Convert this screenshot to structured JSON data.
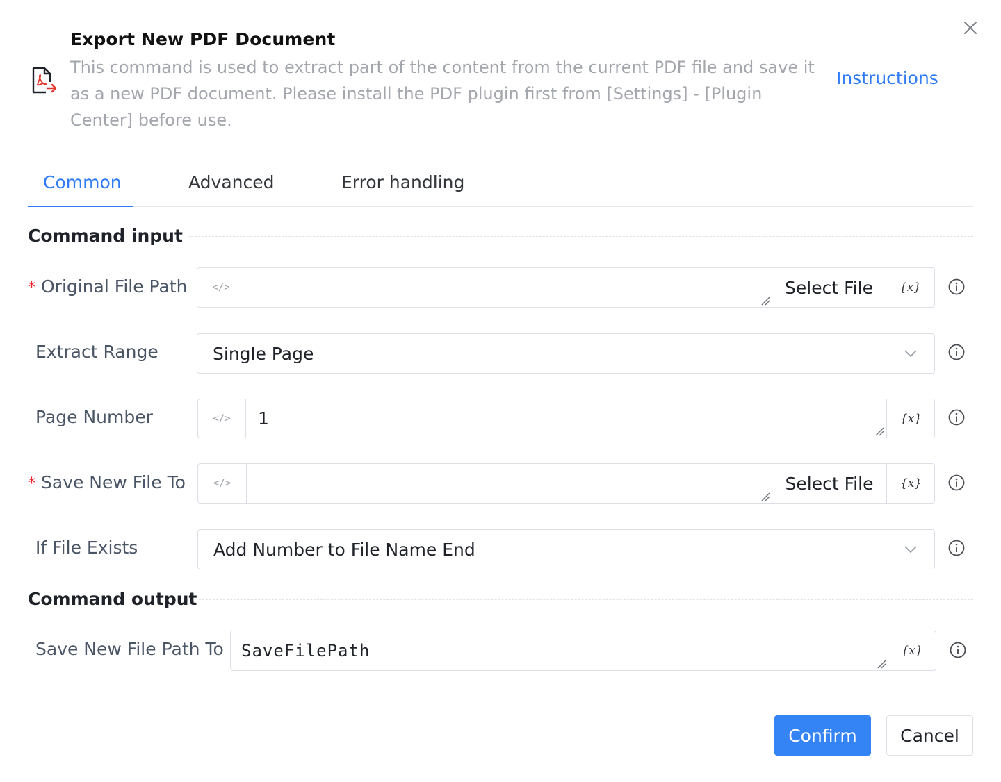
{
  "header": {
    "title": "Export New PDF Document",
    "description": "This command is used to extract part of the content from the current PDF file and save it as a new PDF document. Please install the PDF plugin first from [Settings] - [Plugin Center] before use.",
    "instructions_link": "Instructions",
    "icon": "pdf-export-icon"
  },
  "tabs": [
    {
      "label": "Common",
      "active": true
    },
    {
      "label": "Advanced",
      "active": false
    },
    {
      "label": "Error handling",
      "active": false
    }
  ],
  "sections": {
    "input_title": "Command input",
    "output_title": "Command output"
  },
  "fields": {
    "original_file_path": {
      "label": "Original File Path",
      "required_mark": "*",
      "value": "",
      "button": "Select File"
    },
    "extract_range": {
      "label": "Extract Range",
      "value": "Single Page"
    },
    "page_number": {
      "label": "Page Number",
      "value": "1"
    },
    "save_new_file_to": {
      "label": "Save New File To",
      "required_mark": "*",
      "value": "",
      "button": "Select File"
    },
    "if_file_exists": {
      "label": "If File Exists",
      "value": "Add Number to File Name End"
    },
    "save_new_file_path_to": {
      "label": "Save New File Path To",
      "value": "SaveFilePath"
    }
  },
  "glyphs": {
    "code": "</>",
    "variable": "{x}"
  },
  "buttons": {
    "confirm": "Confirm",
    "cancel": "Cancel"
  },
  "colors": {
    "accent": "#2f7cf6",
    "required": "#f5222d",
    "pdf_red": "#e5352b"
  }
}
